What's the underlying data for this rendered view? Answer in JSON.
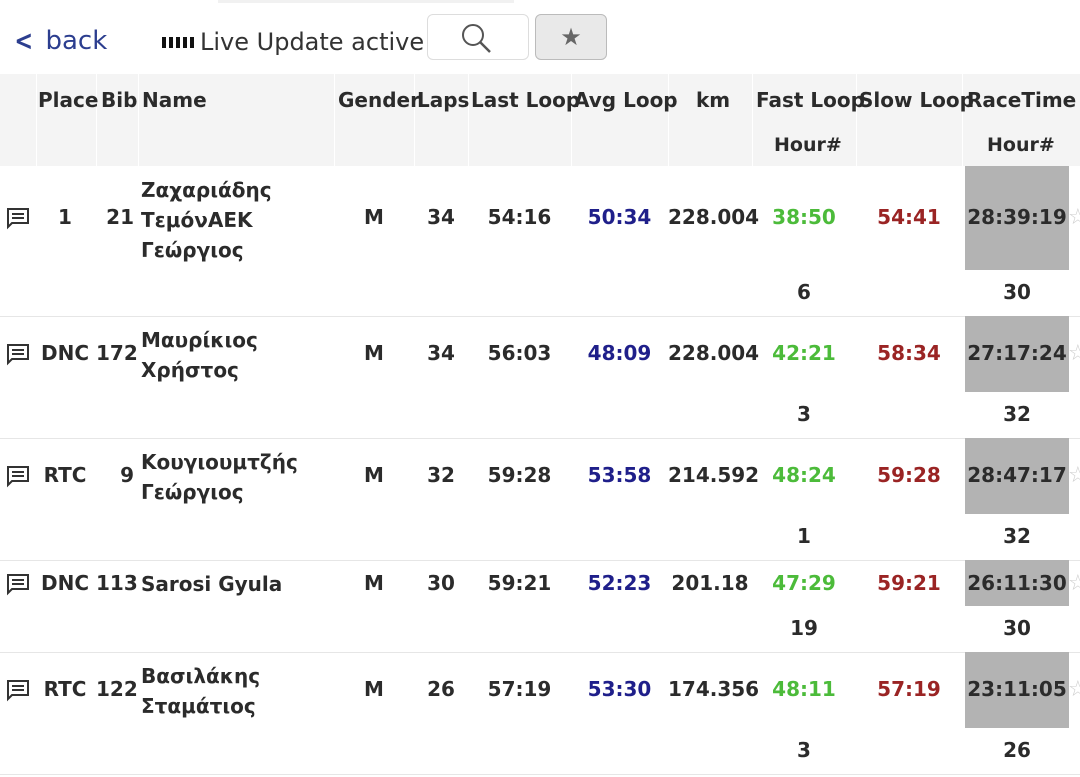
{
  "nav": {
    "back_label": "back",
    "live_label": "Live Update active",
    "search_icon": "search-icon",
    "favorite_icon": "star-icon"
  },
  "table": {
    "headers": {
      "place": "Place",
      "bib": "Bib",
      "name": "Name",
      "gender": "Gender",
      "laps": "Laps",
      "last_loop": "Last Loop",
      "avg_loop": "Avg Loop",
      "km": "km",
      "fast_loop": "Fast Loop",
      "slow_loop": "Slow Loop",
      "race_time": "RaceTime",
      "fast_sub": "Hour#",
      "race_sub": "Hour#"
    },
    "rows": [
      {
        "place": "1",
        "bib": "21",
        "name_lines": [
          "Ζαχαριάδης",
          "ΤεμόνΑΕΚ",
          "Γεώργιος"
        ],
        "gender": "M",
        "laps": "34",
        "last_loop": "54:16",
        "avg_loop": "50:34",
        "km": "228.004",
        "fast_loop": "38:50",
        "slow_loop": "54:41",
        "race_time": "28:39:19",
        "fast_hour": "6",
        "race_hour": "30"
      },
      {
        "place": "DNC",
        "bib": "172",
        "name_lines": [
          "Μαυρίκιος",
          "Χρήστος"
        ],
        "gender": "M",
        "laps": "34",
        "last_loop": "56:03",
        "avg_loop": "48:09",
        "km": "228.004",
        "fast_loop": "42:21",
        "slow_loop": "58:34",
        "race_time": "27:17:24",
        "fast_hour": "3",
        "race_hour": "32"
      },
      {
        "place": "RTC",
        "bib": "9",
        "name_lines": [
          "Κουγιουμτζής",
          "Γεώργιος"
        ],
        "gender": "M",
        "laps": "32",
        "last_loop": "59:28",
        "avg_loop": "53:58",
        "km": "214.592",
        "fast_loop": "48:24",
        "slow_loop": "59:28",
        "race_time": "28:47:17",
        "fast_hour": "1",
        "race_hour": "32"
      },
      {
        "place": "DNC",
        "bib": "113",
        "name_lines": [
          "Sarosi Gyula"
        ],
        "gender": "M",
        "laps": "30",
        "last_loop": "59:21",
        "avg_loop": "52:23",
        "km": "201.18",
        "fast_loop": "47:29",
        "slow_loop": "59:21",
        "race_time": "26:11:30",
        "fast_hour": "19",
        "race_hour": "30"
      },
      {
        "place": "RTC",
        "bib": "122",
        "name_lines": [
          "Βασιλάκης",
          "Σταμάτιος"
        ],
        "gender": "M",
        "laps": "26",
        "last_loop": "57:19",
        "avg_loop": "53:30",
        "km": "174.356",
        "fast_loop": "48:11",
        "slow_loop": "57:19",
        "race_time": "23:11:05",
        "fast_hour": "3",
        "race_hour": "26"
      }
    ]
  },
  "colors": {
    "avg_loop": "#1f1f8a",
    "fast_loop": "#4cbb3a",
    "slow_loop": "#9a2424",
    "race_time_bg": "#b3b3b3",
    "link": "#2c3e8f"
  }
}
